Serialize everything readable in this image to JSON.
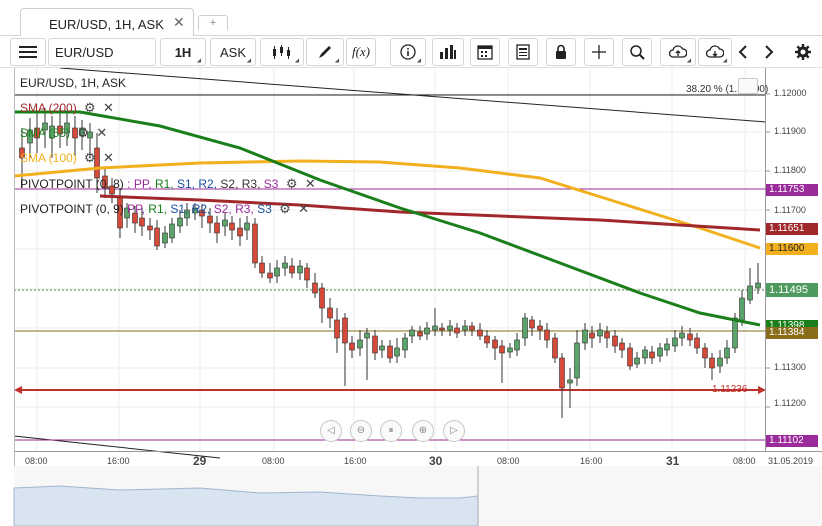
{
  "tab": {
    "title": "EUR/USD, 1H, ASK",
    "close": "✕",
    "add": "+"
  },
  "toolbar": {
    "symbol": "EUR/USD",
    "period": "1H",
    "side": "ASK",
    "fx_label": "f(x)"
  },
  "chart": {
    "title": "EUR/USD, 1H, ASK",
    "fib_label": "38.20 % (1.12000)",
    "indicators": [
      {
        "label": "SMA (200)",
        "color": "#a0282a"
      },
      {
        "label": "SMA (55)",
        "color": "#1a7f1a"
      },
      {
        "label": "SMA (100)",
        "color": "#f2b01e"
      }
    ],
    "pivot1": {
      "prefix": "PIVOTPOINT (0, 8)",
      "parts": [
        ":",
        "PP,",
        "R1,",
        "S1,",
        "R2,",
        "S2,",
        "R3,",
        "S3"
      ]
    },
    "pivot2": {
      "prefix": "PIVOTPOINT (0, 9)",
      "parts": [
        "PP,",
        "R1,",
        "S1,",
        "R2,",
        "S2,",
        "R3,",
        "S3"
      ]
    },
    "price_axis": [
      "1.12000",
      "1.11900",
      "1.11800",
      "1.11700",
      "1.11600",
      "1.11500",
      "1.11400",
      "1.11300",
      "1.11200"
    ],
    "price_tags": {
      "r1": "1.11753",
      "sma200": "1.11651",
      "sma100": "1.11600",
      "current": "1.11495",
      "sma55": "1.11398",
      "pivot": "1.11384",
      "s1": "1.11102",
      "hline": "1.11236"
    },
    "time_axis": [
      "08:00",
      "16:00",
      "29",
      "08:00",
      "16:00",
      "30",
      "08:00",
      "16:00",
      "31",
      "08:00",
      "31.05.2019"
    ],
    "colors": {
      "up": "#5aa46a",
      "down": "#d64a3a",
      "sma200": "#a0282a",
      "sma55": "#1a7f1a",
      "sma100": "#f2b01e",
      "pivot_purple": "#9b2a9b",
      "hline": "#c0302a"
    }
  }
}
